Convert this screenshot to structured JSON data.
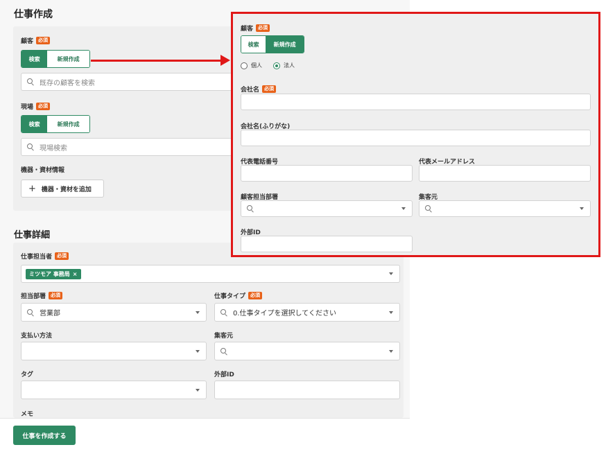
{
  "page": {
    "title": "仕事作成"
  },
  "customer": {
    "label": "顧客",
    "required": "必須",
    "tab_search": "検索",
    "tab_new": "新規作成",
    "search_placeholder": "既存の顧客を検索"
  },
  "site": {
    "label": "現場",
    "required": "必須",
    "tab_search": "検索",
    "tab_new": "新規作成",
    "search_placeholder": "現場検索"
  },
  "equipment": {
    "label": "機器・資材情報",
    "add_button": "機器・資材を追加"
  },
  "job_details": {
    "title": "仕事詳細",
    "assignee_label": "仕事担当者",
    "assignee_required": "必須",
    "assignee_chip": "ミツモア 事務局",
    "assignee_chip_remove": "×",
    "department_label": "担当部署",
    "department_required": "必須",
    "department_value": "営業部",
    "job_type_label": "仕事タイプ",
    "job_type_required": "必須",
    "job_type_value": "0.仕事タイプを選択してください",
    "payment_label": "支払い方法",
    "acquisition_label": "集客元",
    "tag_label": "タグ",
    "external_id_label": "外部ID",
    "memo_label": "メモ"
  },
  "footer": {
    "submit_label": "仕事を作成する"
  },
  "zoom_panel": {
    "customer_label": "顧客",
    "required": "必須",
    "tab_search": "検索",
    "tab_new": "新規作成",
    "radio_individual": "個人",
    "radio_corporate": "法人",
    "company_name_label": "会社名",
    "company_name_required": "必須",
    "company_kana_label": "会社名(ふりがな)",
    "phone_label": "代表電話番号",
    "email_label": "代表メールアドレス",
    "customer_department_label": "顧客担当部署",
    "acquisition_label": "集客元",
    "external_id_label": "外部ID"
  },
  "colors": {
    "brand_green": "#2e8a63",
    "required_orange": "#e8621a",
    "highlight_red": "#e01818"
  }
}
